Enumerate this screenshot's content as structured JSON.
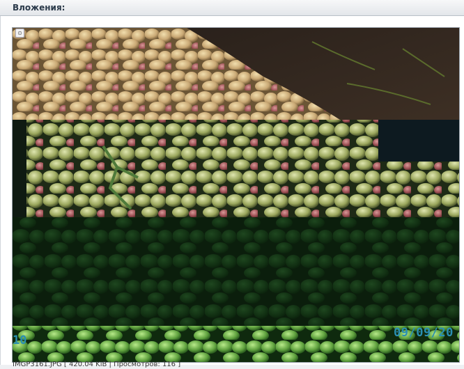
{
  "section": {
    "title": "Вложения:"
  },
  "attachment": {
    "date_stamp": "09/09/20",
    "frame_number": "10",
    "caption": "IMGP3161.JPG [ 420.04 KiB | Просмотров: 116 ]"
  },
  "colors": {
    "header_text": "#2b3a4a",
    "date_stamp": "#2a8fb3"
  },
  "icons": {
    "corner": "zoom-icon"
  }
}
